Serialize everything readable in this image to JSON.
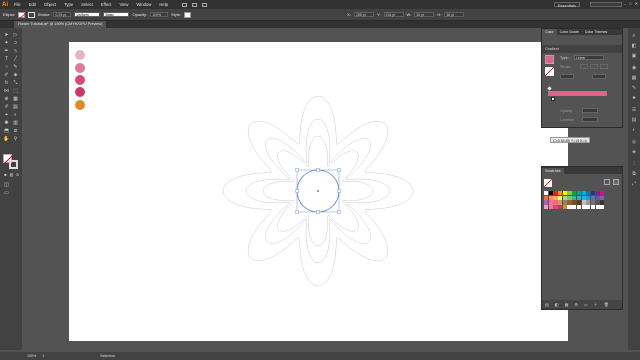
{
  "app": {
    "logo": "Ai"
  },
  "menu": [
    "File",
    "Edit",
    "Object",
    "Type",
    "Select",
    "Effect",
    "View",
    "Window",
    "Help"
  ],
  "workspace": "Essentials",
  "window_controls": [
    "–",
    "□",
    "✕"
  ],
  "control_bar": {
    "selection_label": "Ellipse",
    "stroke_label": "Stroke:",
    "stroke_value": "0.25 pt",
    "uniform_label": "Uniform",
    "style_label": "Basic",
    "opacity_label": "Opacity:",
    "opacity_value": "100%",
    "style_short": "Style:",
    "x_value": "288 pt",
    "y_value": "216 pt",
    "w_value": "36 pt",
    "h_value": "36 pt"
  },
  "document_tab": "Flower Tutorial.ai* @ 150% (CMYK/GPU Preview)",
  "status_bar": {
    "zoom": "150%",
    "page": "1",
    "tool": "Selection"
  },
  "artboard_dots": [
    {
      "color": "#e8b4c4"
    },
    {
      "color": "#e07a9e"
    },
    {
      "color": "#d44a78"
    },
    {
      "color": "#c93a6a"
    },
    {
      "color": "#e08a2c"
    }
  ],
  "color_panel": {
    "tabs": [
      "Color",
      "Color Guide",
      "Color Themes"
    ],
    "gradient_title": "Gradient",
    "type_label": "Type:",
    "type_value": "Linear",
    "stroke_label": "Stroke:",
    "opacity_label": "Opacity:",
    "location_label": "Location:",
    "accent": "#e06488",
    "tooltip": "C=0 M=85 Y=19 K=0"
  },
  "swatches_panel": {
    "title": "Swatches",
    "colors": [
      "#ffffff",
      "#000000",
      "#ed1c24",
      "#f7941d",
      "#fff200",
      "#8dc63f",
      "#00a651",
      "#00a99d",
      "#00aeef",
      "#0072bc",
      "#2e3192",
      "#662d91",
      "#ec008c",
      "#f26c4f",
      "#f68e56",
      "#fbaf5d",
      "#fff568",
      "#acd373",
      "#7cc576",
      "#3cb878",
      "#1cbbb4",
      "#00bff3",
      "#448ccb",
      "#5674b9",
      "#605ca8",
      "#855fa8",
      "#a864a8",
      "#f06eaa",
      "#f26d7d",
      "#c69c6d",
      "#a67c52",
      "#8c6239",
      "#754c24",
      "#603913",
      "#c2c2c2",
      "#999999",
      "#737373",
      "#555555",
      "#363636",
      "#e6a4b8",
      "#e07a9e",
      "#d44a78",
      "#c93a6a",
      "#e08a2c",
      "#ffffff",
      "#ffffff",
      "#ffffff",
      "#ffffff",
      "#ffffff",
      "#ffffff",
      "#ffffff",
      "#ffffff"
    ]
  }
}
